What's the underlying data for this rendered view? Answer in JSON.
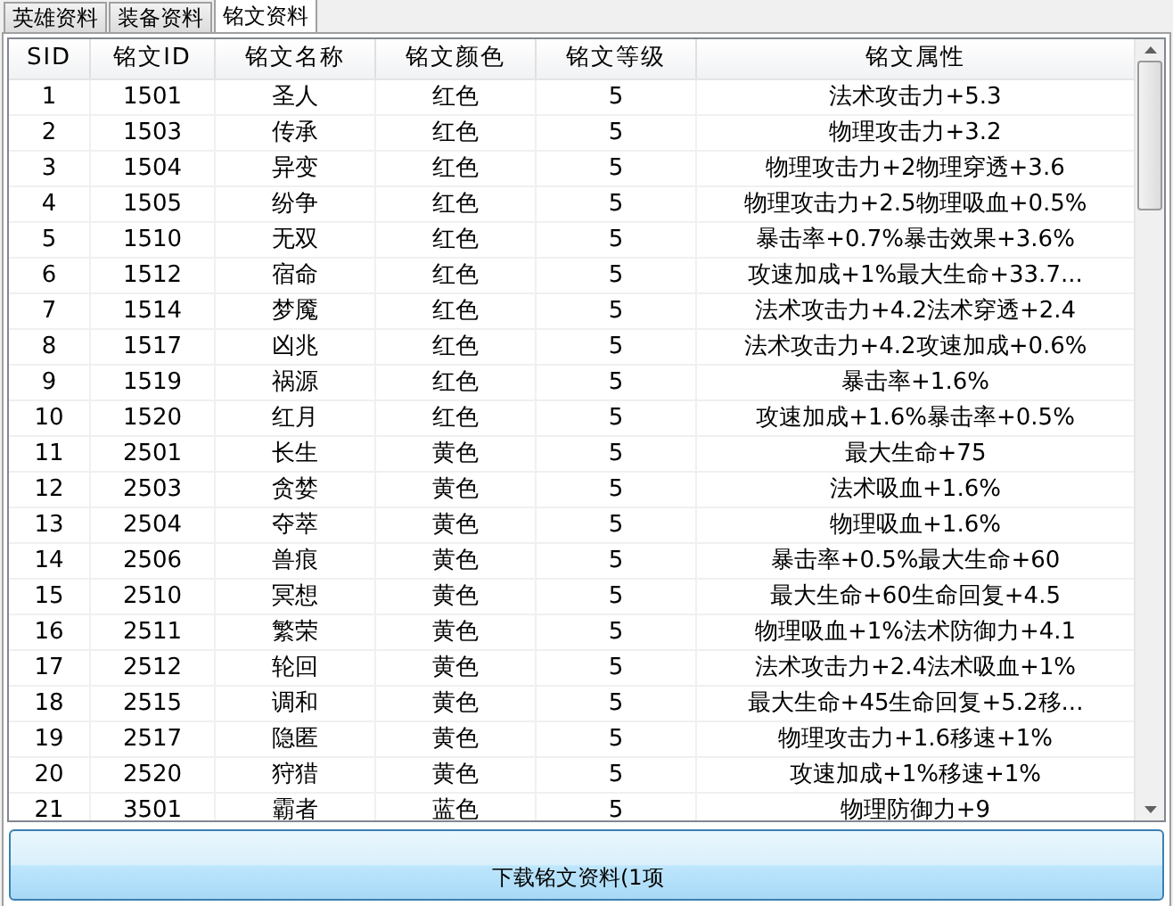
{
  "tabs": [
    {
      "label": "英雄资料",
      "selected": false
    },
    {
      "label": "装备资料",
      "selected": false
    },
    {
      "label": "铭文资料",
      "selected": true
    }
  ],
  "table": {
    "columns": [
      "SID",
      "铭文ID",
      "铭文名称",
      "铭文颜色",
      "铭文等级",
      "铭文属性"
    ],
    "rows": [
      [
        "1",
        "1501",
        "圣人",
        "红色",
        "5",
        "法术攻击力+5.3"
      ],
      [
        "2",
        "1503",
        "传承",
        "红色",
        "5",
        "物理攻击力+3.2"
      ],
      [
        "3",
        "1504",
        "异变",
        "红色",
        "5",
        "物理攻击力+2物理穿透+3.6"
      ],
      [
        "4",
        "1505",
        "纷争",
        "红色",
        "5",
        "物理攻击力+2.5物理吸血+0.5%"
      ],
      [
        "5",
        "1510",
        "无双",
        "红色",
        "5",
        "暴击率+0.7%暴击效果+3.6%"
      ],
      [
        "6",
        "1512",
        "宿命",
        "红色",
        "5",
        "攻速加成+1%最大生命+33.7..."
      ],
      [
        "7",
        "1514",
        "梦魇",
        "红色",
        "5",
        "法术攻击力+4.2法术穿透+2.4"
      ],
      [
        "8",
        "1517",
        "凶兆",
        "红色",
        "5",
        "法术攻击力+4.2攻速加成+0.6%"
      ],
      [
        "9",
        "1519",
        "祸源",
        "红色",
        "5",
        "暴击率+1.6%"
      ],
      [
        "10",
        "1520",
        "红月",
        "红色",
        "5",
        "攻速加成+1.6%暴击率+0.5%"
      ],
      [
        "11",
        "2501",
        "长生",
        "黄色",
        "5",
        "最大生命+75"
      ],
      [
        "12",
        "2503",
        "贪婪",
        "黄色",
        "5",
        "法术吸血+1.6%"
      ],
      [
        "13",
        "2504",
        "夺萃",
        "黄色",
        "5",
        "物理吸血+1.6%"
      ],
      [
        "14",
        "2506",
        "兽痕",
        "黄色",
        "5",
        "暴击率+0.5%最大生命+60"
      ],
      [
        "15",
        "2510",
        "冥想",
        "黄色",
        "5",
        "最大生命+60生命回复+4.5"
      ],
      [
        "16",
        "2511",
        "繁荣",
        "黄色",
        "5",
        "物理吸血+1%法术防御力+4.1"
      ],
      [
        "17",
        "2512",
        "轮回",
        "黄色",
        "5",
        "法术攻击力+2.4法术吸血+1%"
      ],
      [
        "18",
        "2515",
        "调和",
        "黄色",
        "5",
        "最大生命+45生命回复+5.2移..."
      ],
      [
        "19",
        "2517",
        "隐匿",
        "黄色",
        "5",
        "物理攻击力+1.6移速+1%"
      ],
      [
        "20",
        "2520",
        "狩猎",
        "黄色",
        "5",
        "攻速加成+1%移速+1%"
      ],
      [
        "21",
        "3501",
        "霸者",
        "蓝色",
        "5",
        "物理防御力+9"
      ]
    ]
  },
  "download_button": "下载铭文资料(1项"
}
